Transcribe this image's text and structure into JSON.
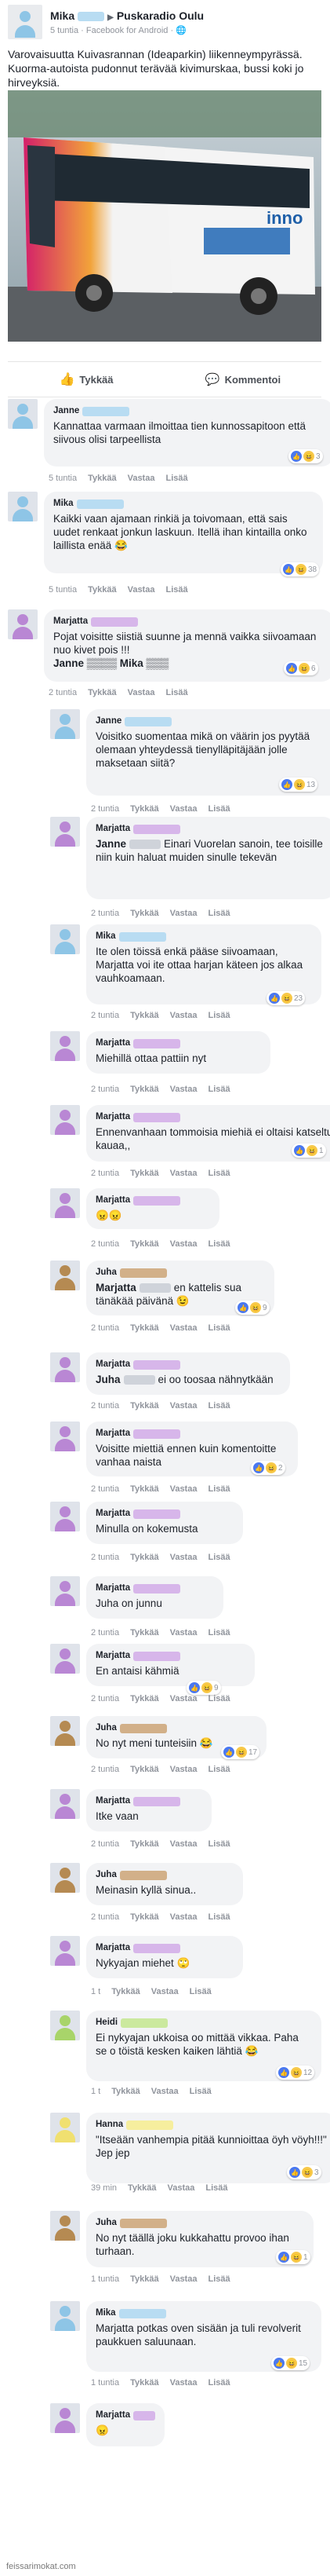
{
  "post": {
    "author": "Mika",
    "arrow": "▶",
    "page": "Puskaradio Oulu",
    "meta": "5 tuntia · Facebook for Android · 🌐",
    "text": "Varovaisuutta Kuivasrannan (Ideaparkin) liikenneympyrässä. Kuorma-autoista pudonnut terävää kivimurskaa, bussi koki jo hirveyksiä.",
    "image_bus_brand": "inno",
    "like_label": "Tykkää",
    "comment_label": "Kommentoi"
  },
  "comments": [
    {
      "name": "Janne",
      "gender": "m",
      "text": "Kannattaa varmaan ilmoittaa tien kunnossapitoon että siivous olisi tarpeellista",
      "meta": [
        "5 tuntia",
        "Tykkää",
        "Vastaa",
        "Lisää"
      ],
      "reacts": "3"
    },
    {
      "name": "Mika",
      "gender": "m",
      "text": "Kaikki vaan ajamaan rinkiä ja toivomaan, että sais uudet renkaat jonkun laskuun. Itellä ihan kintailla onko laillista enää 😂",
      "meta": [
        "5 tuntia",
        "Tykkää",
        "Vastaa",
        "Lisää"
      ],
      "reacts": "38"
    },
    {
      "name": "Marjatta",
      "gender": "f",
      "text": "Pojat voisitte siistiä suunne ja mennä vaikka siivoamaan nuo kivet pois !!!",
      "tag": "Janne ▒▒▒▒  Mika ▒▒▒",
      "meta": [
        "2 tuntia",
        "Tykkää",
        "Vastaa",
        "Lisää"
      ],
      "reacts": "6"
    },
    {
      "name": "Janne",
      "gender": "m",
      "text": "Voisitko suomentaa mikä on väärin jos pyytää olemaan yhteydessä tienylläpitäjään jolle maksetaan siitä?",
      "meta": [
        "2 tuntia",
        "Tykkää",
        "Vastaa",
        "Lisää"
      ],
      "reacts": "13"
    },
    {
      "name": "Marjatta",
      "gender": "f",
      "text": "Einari Vuorelan sanoin, tee toisille niin kuin haluat muiden sinulle tekevän",
      "tagname": "Janne",
      "meta": [
        "2 tuntia",
        "Tykkää",
        "Vastaa",
        "Lisää"
      ],
      "reacts": ""
    },
    {
      "name": "Mika",
      "gender": "m",
      "text": "Ite olen töissä enkä pääse siivoamaan, Marjatta voi ite ottaa harjan käteen jos alkaa vauhkoamaan.",
      "meta": [
        "2 tuntia",
        "Tykkää",
        "Vastaa",
        "Lisää"
      ],
      "reacts": "23"
    },
    {
      "name": "Marjatta",
      "gender": "f",
      "text": "Miehillä ottaa pattiin nyt",
      "meta": [
        "2 tuntia",
        "Tykkää",
        "Vastaa",
        "Lisää"
      ],
      "reacts": ""
    },
    {
      "name": "Marjatta",
      "gender": "f",
      "text": "Ennenvanhaan tommoisia miehiä ei oltaisi katseltu kauaa,,",
      "meta": [
        "2 tuntia",
        "Tykkää",
        "Vastaa",
        "Lisää"
      ],
      "reacts": "1"
    },
    {
      "name": "Marjatta",
      "gender": "f",
      "text": "😠😠",
      "meta": [
        "2 tuntia",
        "Tykkää",
        "Vastaa",
        "Lisää"
      ],
      "reacts": ""
    },
    {
      "name": "Juha",
      "gender": "b",
      "text": "en kattelis sua tänäkää päivänä 😉",
      "tagname": "Marjatta",
      "meta": [
        "2 tuntia",
        "Tykkää",
        "Vastaa",
        "Lisää"
      ],
      "reacts": "9"
    },
    {
      "name": "Marjatta",
      "gender": "f",
      "text": "ei oo toosaa nähnytkään",
      "tagname": "Juha",
      "meta": [
        "2 tuntia",
        "Tykkää",
        "Vastaa",
        "Lisää"
      ],
      "reacts": ""
    },
    {
      "name": "Marjatta",
      "gender": "f",
      "text": "Voisitte miettiä ennen kuin komentoitte vanhaa naista",
      "meta": [
        "2 tuntia",
        "Tykkää",
        "Vastaa",
        "Lisää"
      ],
      "reacts": "2"
    },
    {
      "name": "Marjatta",
      "gender": "f",
      "text": "Minulla on kokemusta",
      "meta": [
        "2 tuntia",
        "Tykkää",
        "Vastaa",
        "Lisää"
      ],
      "reacts": ""
    },
    {
      "name": "Marjatta",
      "gender": "f",
      "text": "Juha on junnu",
      "meta": [
        "2 tuntia",
        "Tykkää",
        "Vastaa",
        "Lisää"
      ],
      "reacts": ""
    },
    {
      "name": "Marjatta",
      "gender": "f",
      "text": "En antaisi kähmiä",
      "meta": [
        "2 tuntia",
        "Tykkää",
        "Vastaa",
        "Lisää"
      ],
      "reacts": "9"
    },
    {
      "name": "Juha",
      "gender": "b",
      "text": "No nyt meni tunteisiin 😂",
      "meta": [
        "2 tuntia",
        "Tykkää",
        "Vastaa",
        "Lisää"
      ],
      "reacts": "17"
    },
    {
      "name": "Marjatta",
      "gender": "f",
      "text": "Itke vaan",
      "meta": [
        "2 tuntia",
        "Tykkää",
        "Vastaa",
        "Lisää"
      ],
      "reacts": ""
    },
    {
      "name": "Juha",
      "gender": "b",
      "text": "Meinasin kyllä sinua..",
      "meta": [
        "2 tuntia",
        "Tykkää",
        "Vastaa",
        "Lisää"
      ],
      "reacts": ""
    },
    {
      "name": "Marjatta",
      "gender": "f",
      "text": "Nykyajan miehet 🙄",
      "meta": [
        "1 t",
        "Tykkää",
        "Vastaa",
        "Lisää"
      ],
      "reacts": ""
    },
    {
      "name": "Heidi",
      "gender": "g",
      "text": "Ei nykyajan ukkoisa oo mittää vikkaa. Paha se o töistä kesken kaiken lähtiä 😂",
      "meta": [
        "1 t",
        "Tykkää",
        "Vastaa",
        "Lisää"
      ],
      "reacts": "12"
    },
    {
      "name": "Hanna",
      "gender": "y",
      "text": "\"Itseään vanhempia pitää kunnioittaa öyh vöyh!!!\" Jep jep",
      "meta": [
        "39 min",
        "Tykkää",
        "Vastaa",
        "Lisää"
      ],
      "reacts": "3"
    },
    {
      "name": "Juha",
      "gender": "b",
      "text": "No nyt täällä joku kukkahattu provoo ihan turhaan.",
      "meta": [
        "1 tuntia",
        "Tykkää",
        "Vastaa",
        "Lisää"
      ],
      "reacts": "1"
    },
    {
      "name": "Mika",
      "gender": "m",
      "text": "Marjatta potkas oven sisään ja tuli revolverit paukkuen saluunaan.",
      "meta": [
        "1 tuntia",
        "Tykkää",
        "Vastaa",
        "Lisää"
      ],
      "reacts": "15"
    },
    {
      "name": "Marjatta",
      "gender": "f",
      "text": "😠",
      "meta": [],
      "reacts": ""
    }
  ],
  "watermark": "feissarimokat.com",
  "colors": {
    "m": "#8ec5e6",
    "f": "#b987d4",
    "b": "#b58a52",
    "g": "#a8d46a",
    "y": "#f0e070"
  }
}
